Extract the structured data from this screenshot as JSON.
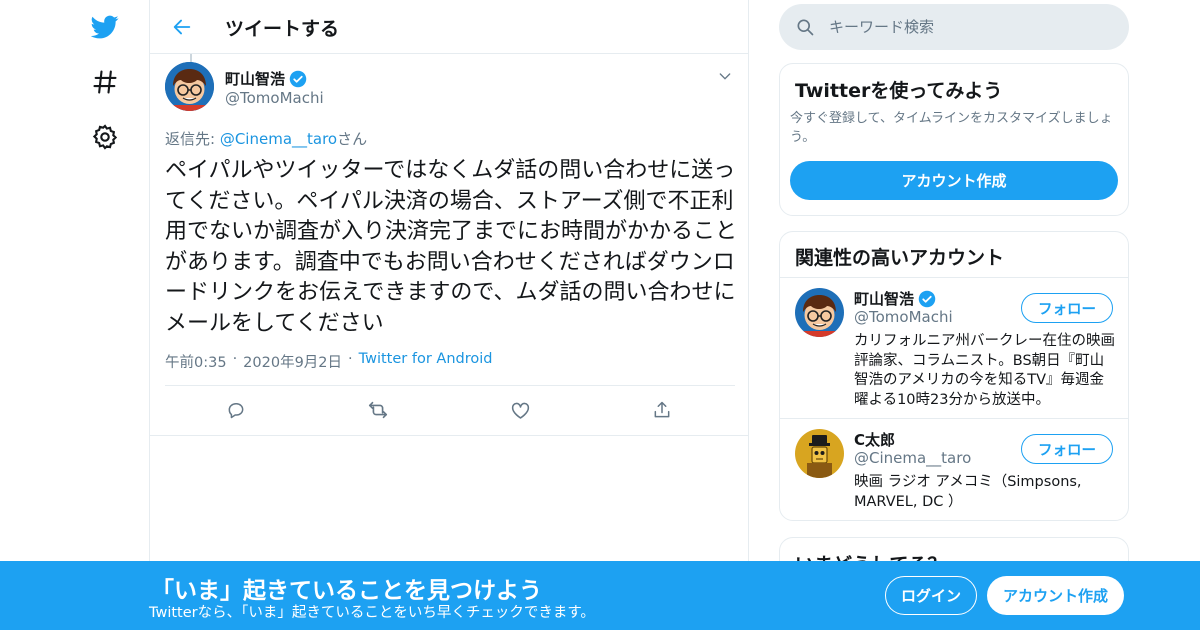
{
  "colors": {
    "accent": "#1da1f2",
    "link": "#1b95e0",
    "muted": "#657786",
    "text": "#14171a",
    "border": "#e6ecf0"
  },
  "nav": {
    "icons": [
      "twitter-bird-icon",
      "hashtag-icon",
      "gear-icon"
    ]
  },
  "header": {
    "title": "ツイートする",
    "back_icon": "arrow-left-icon"
  },
  "tweet": {
    "author_name": "町山智浩",
    "author_handle": "@TomoMachi",
    "verified": true,
    "reply_prefix": "返信先: ",
    "reply_user": "@Cinema__taro",
    "reply_suffix": "さん",
    "text": "ペイパルやツイッターではなくムダ話の問い合わせに送ってください。ペイパル決済の場合、ストアーズ側で不正利用でないか調査が入り決済完了までにお時間がかかることがあります。調査中でもお問い合わせくださればダウンロードリンクをお伝えできますので、ムダ話の問い合わせにメールをしてください",
    "time": "午前0:35",
    "date": "2020年9月2日",
    "source": "Twitter for Android",
    "sep": "·",
    "actions": [
      "reply-icon",
      "retweet-icon",
      "like-icon",
      "share-icon"
    ]
  },
  "search": {
    "placeholder": "キーワード検索"
  },
  "signup_card": {
    "title": "Twitterを使ってみよう",
    "desc": "今すぐ登録して、タイムラインをカスタマイズしましょう。",
    "button": "アカウント作成"
  },
  "related": {
    "title": "関連性の高いアカウント",
    "accounts": [
      {
        "name": "町山智浩",
        "handle": "@TomoMachi",
        "verified": true,
        "bio": "カリフォルニア州バークレー在住の映画評論家、コラムニスト。BS朝日『町山智浩のアメリカの今を知るTV』毎週金曜よる10時23分から放送中。",
        "follow": "フォロー"
      },
      {
        "name": "C太郎",
        "handle": "@Cinema__taro",
        "verified": false,
        "bio": "映画 ラジオ アメコミ（Simpsons, MARVEL, DC ）",
        "follow": "フォロー"
      }
    ]
  },
  "whats_happening": {
    "title": "いまどうしてる？"
  },
  "banner": {
    "title": "「いま」起きていることを見つけよう",
    "subtitle": "Twitterなら、「いま」起きていることをいち早くチェックできます。",
    "login": "ログイン",
    "signup": "アカウント作成"
  }
}
